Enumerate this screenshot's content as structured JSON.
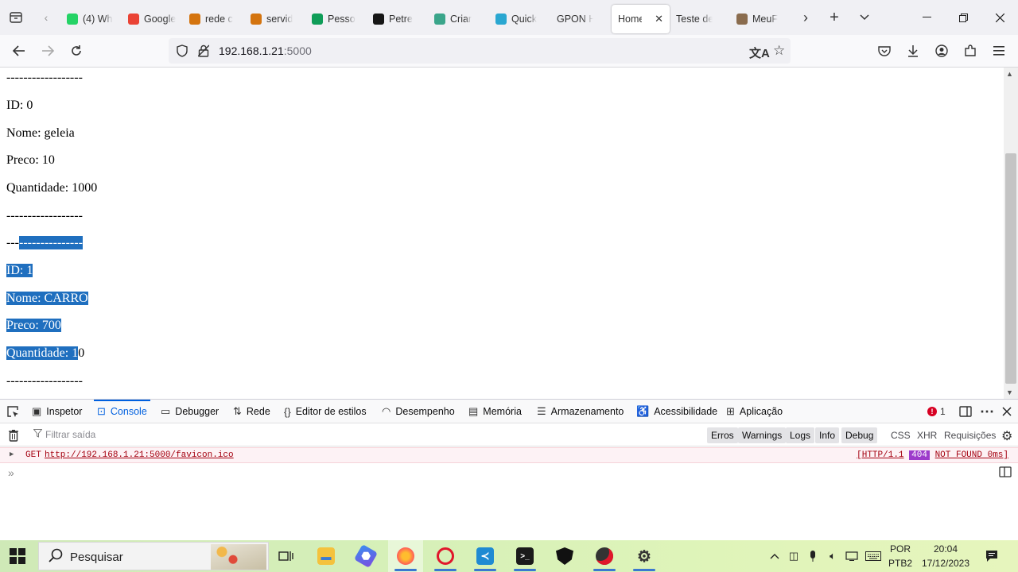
{
  "browser": {
    "tabs": [
      {
        "label": "(4) Wh",
        "favicon_color": "#25d366",
        "favicon_icon": "whatsapp-icon"
      },
      {
        "label": "Google",
        "favicon_color": "#ea4335",
        "favicon_icon": "google-meet-icon"
      },
      {
        "label": "rede c",
        "favicon_color": "#d4740f",
        "favicon_icon": "grid-logo-icon"
      },
      {
        "label": "servid",
        "favicon_color": "#d4740f",
        "favicon_icon": "grid-logo-icon"
      },
      {
        "label": "Pesso",
        "favicon_color": "#0f9d58",
        "favicon_icon": "google-drive-icon"
      },
      {
        "label": "Petre",
        "favicon_color": "#161616",
        "favicon_icon": "github-icon"
      },
      {
        "label": "Criar",
        "favicon_color": "#3aa58a",
        "favicon_icon": "chatgpt-icon"
      },
      {
        "label": "Quick",
        "favicon_color": "#2aa7d1",
        "favicon_icon": "flutter-icon"
      },
      {
        "label": "GPON Ho",
        "favicon_color": "",
        "favicon_icon": ""
      },
      {
        "label": "Home",
        "favicon_color": "",
        "favicon_icon": "",
        "active": true
      },
      {
        "label": "Teste de P",
        "favicon_color": "",
        "favicon_icon": ""
      },
      {
        "label": "MeuF",
        "favicon_color": "#8a6c4e",
        "favicon_icon": "image-icon"
      }
    ],
    "url_host": "192.168.1.21",
    "url_port": ":5000"
  },
  "page": {
    "lines": [
      {
        "text": "------------------"
      },
      {
        "text": "ID: 0"
      },
      {
        "text": "Nome: geleia"
      },
      {
        "text": "Preco: 10"
      },
      {
        "text": "Quantidade: 1000"
      },
      {
        "text": "------------------"
      },
      {
        "pre": "---",
        "sel": "---------------",
        "post": ""
      },
      {
        "pre": "",
        "sel": "ID: 1",
        "post": ""
      },
      {
        "pre": "",
        "sel": "Nome: CARRO",
        "post": ""
      },
      {
        "pre": "",
        "sel": "Preco: 700",
        "post": ""
      },
      {
        "pre": "",
        "sel": "Quantidade: 1",
        "post": "0"
      },
      {
        "text": "------------------"
      }
    ]
  },
  "devtools": {
    "tabs": [
      "Inspetor",
      "Console",
      "Debugger",
      "Rede",
      "Editor de estilos",
      "Desempenho",
      "Memória",
      "Armazenamento",
      "Acessibilidade",
      "Aplicação"
    ],
    "active_tab": "Console",
    "error_count": "1",
    "filter_placeholder": "Filtrar saída",
    "filter_pills": [
      "Erros",
      "Warnings",
      "Logs",
      "Info",
      "Debug"
    ],
    "filter_texts": [
      "CSS",
      "XHR",
      "Requisições"
    ],
    "log": {
      "method": "GET",
      "url": "http://192.168.1.21:5000/favicon.ico",
      "status_prefix": "[HTTP/1.1",
      "status_code": "404",
      "status_suffix": "NOT FOUND 0ms]"
    }
  },
  "taskbar": {
    "search_placeholder": "Pesquisar",
    "lang_line1": "POR",
    "lang_line2": "PTB2",
    "time": "20:04",
    "date": "17/12/2023"
  },
  "colors": {
    "selection": "#1f6fbf",
    "devtools_accent": "#0060df",
    "error_red": "#d70022",
    "status_404_bg": "#9d3bcb"
  }
}
